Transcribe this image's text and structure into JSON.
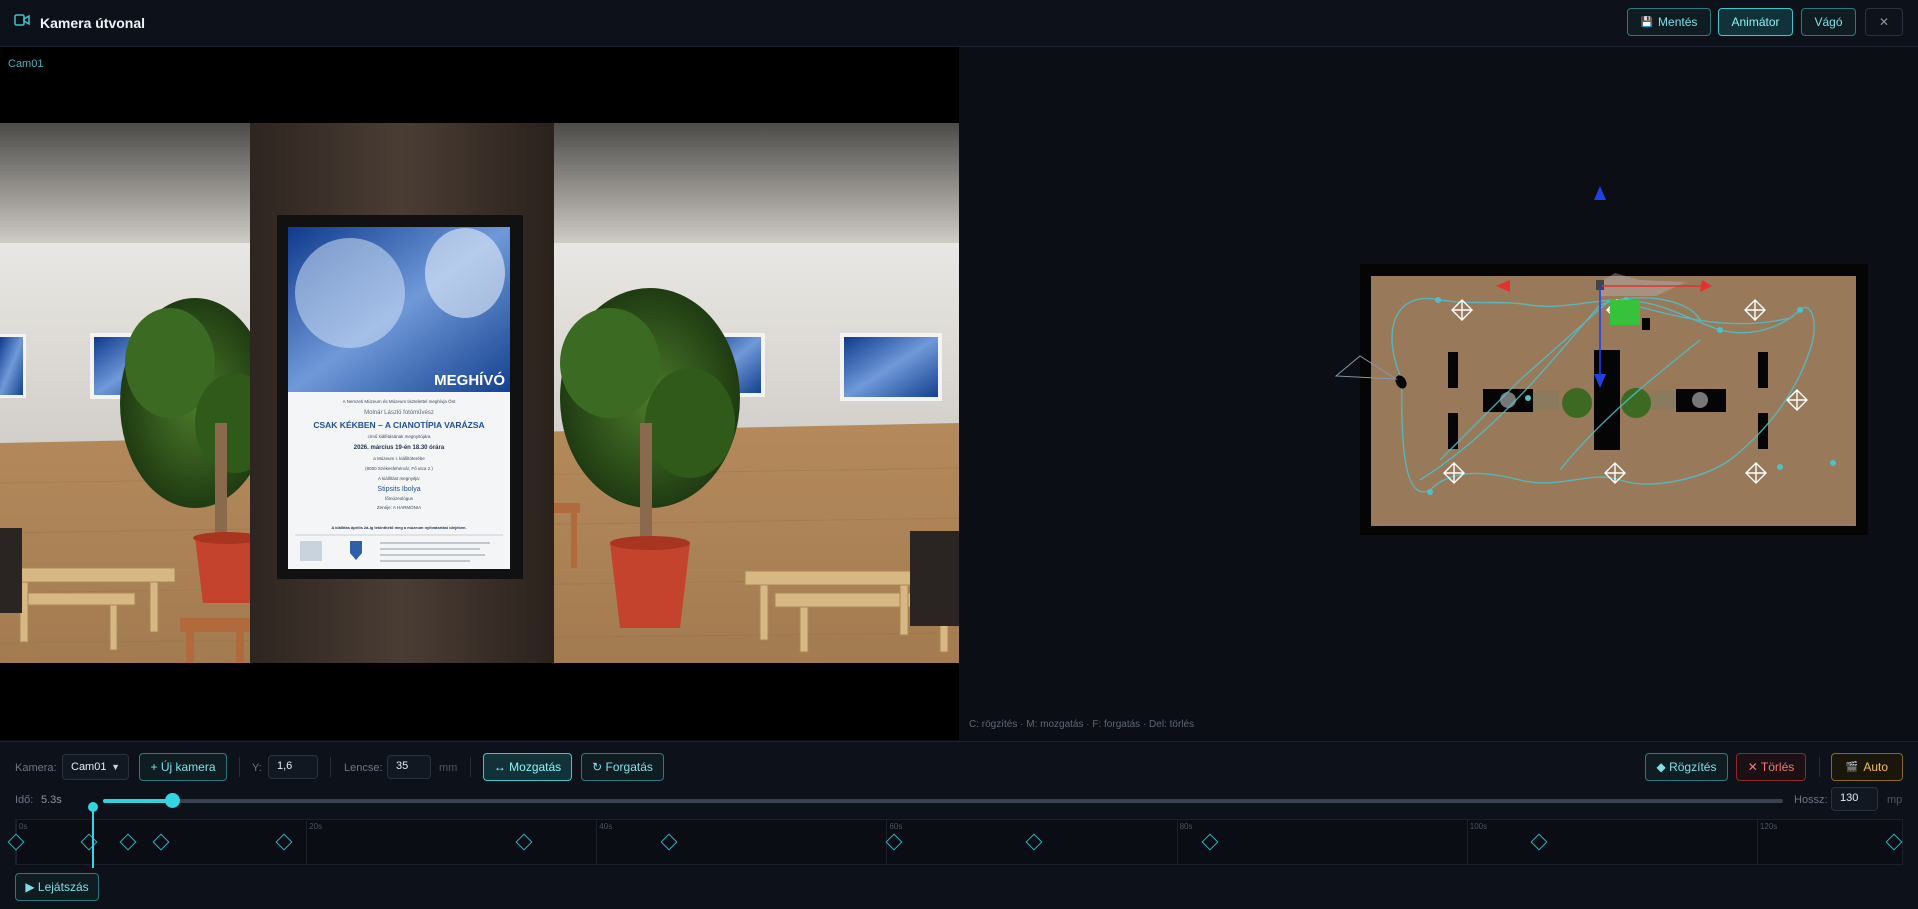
{
  "header": {
    "title": "Kamera útvonal",
    "buttons": {
      "save": "Mentés",
      "save_icon": "💾",
      "animator": "Animátor",
      "cutter": "Vágó",
      "close": "✕"
    }
  },
  "viewport": {
    "camera_label": "Cam01",
    "poster": {
      "title": "MEGHÍVÓ",
      "line1": "A Nemzeti Múzeum és Múzeum tisztelettel meghívja Önt",
      "line2": "Molnár László fotóművész",
      "headline": "CSAK KÉKBEN – A CIANOTÍPIA VARÁZSA",
      "line3": "című kiállításának megnyitójára",
      "date": "2026. március 19-én 18.30 órára",
      "line4": "a Múzeum I. kiállítóterébe",
      "line5": "(8000 Székesfehérvár, Fő utca 2.)",
      "line6": "A kiállítást megnyitja:",
      "opener": "Stipsits Ibolya",
      "line7": "főmúzeológus",
      "line8": "Zenéje: A HARMÓNIA",
      "footer": "A kiállítás április 2á-ig tekinthető meg a múzeum nyitvatartási idejében."
    }
  },
  "map": {
    "hint": "C: rögzítés · M: mozgatás · F: forgatás · Del: törlés"
  },
  "controls": {
    "camera_label": "Kamera:",
    "camera_value": "Cam01",
    "new_camera": "+ Új kamera",
    "y_label": "Y:",
    "y_value": "1,6",
    "lens_label": "Lencse:",
    "lens_value": "35",
    "lens_unit": "mm",
    "move": "↔ Mozgatás",
    "rotate": "↻ Forgatás",
    "record": "◆ Rögzítés",
    "delete": "✕ Törlés",
    "auto": "Auto",
    "auto_icon": "🎬",
    "time_label": "Idő:",
    "time_value": "5.3s",
    "time_fraction": 0.041,
    "length_label": "Hossz:",
    "length_value": "130",
    "length_unit": "mp",
    "play": "▶ Lejátszás"
  },
  "timeline": {
    "duration": 130,
    "tick_labels": [
      "0s",
      "20s",
      "40s",
      "60s",
      "80s",
      "100s",
      "120s"
    ],
    "tick_values": [
      0,
      20,
      40,
      60,
      80,
      100,
      120
    ],
    "keyframes": [
      0,
      5,
      7.7,
      10,
      18.5,
      35,
      45,
      60.5,
      70.2,
      82.3,
      105,
      130
    ]
  }
}
